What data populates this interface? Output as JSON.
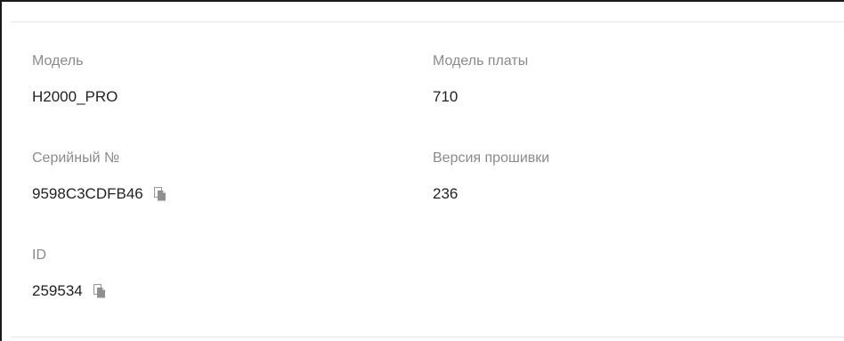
{
  "device_info": {
    "model": {
      "label": "Модель",
      "value": "H2000_PRO"
    },
    "board_model": {
      "label": "Модель платы",
      "value": "710"
    },
    "serial": {
      "label": "Серийный №",
      "value": "9598C3CDFB46",
      "copy_icon": "copy-icon"
    },
    "firmware": {
      "label": "Версия прошивки",
      "value": "236"
    },
    "id": {
      "label": "ID",
      "value": "259534",
      "copy_icon": "copy-icon"
    }
  },
  "colors": {
    "label": "#8a8a8a",
    "value": "#222222",
    "icon": "#9a9a9a",
    "divider": "#e6e6e6"
  }
}
